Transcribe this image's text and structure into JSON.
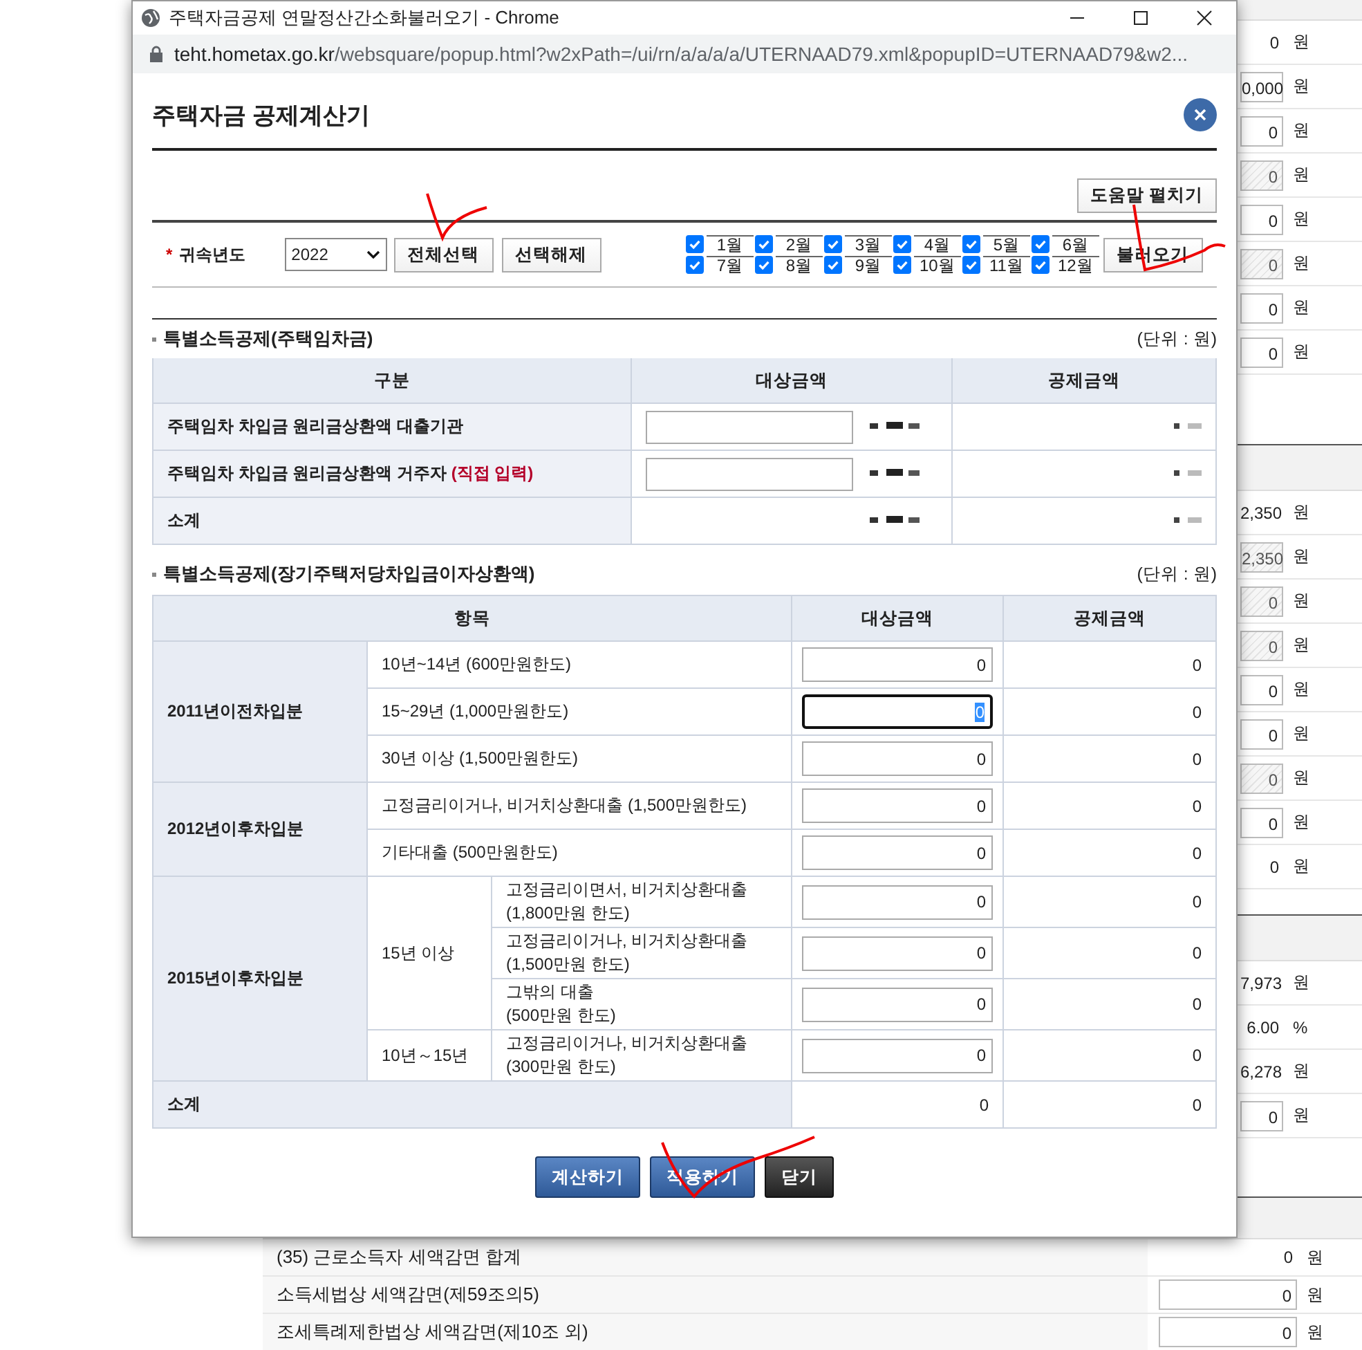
{
  "window": {
    "title": "주택자금공제 연말정산간소화불러오기 - Chrome",
    "url_host": "teht.hometax.go.kr",
    "url_path": "/websquare/popup.html?w2xPath=/ui/rn/a/a/a/a/UTERNAAD79.xml&popupID=UTERNAAD79&w2..."
  },
  "dialog": {
    "title": "주택자금 공제계산기",
    "help_button": "도움말 펼치기",
    "required_mark": "*",
    "year_label": "귀속년도",
    "year_value": "2022",
    "select_all": "전체선택",
    "deselect": "선택해제",
    "load_button": "불러오기",
    "months": [
      {
        "label": "1월",
        "checked": true
      },
      {
        "label": "2월",
        "checked": true
      },
      {
        "label": "3월",
        "checked": true
      },
      {
        "label": "4월",
        "checked": true
      },
      {
        "label": "5월",
        "checked": true
      },
      {
        "label": "6월",
        "checked": true
      },
      {
        "label": "7월",
        "checked": true
      },
      {
        "label": "8월",
        "checked": true
      },
      {
        "label": "9월",
        "checked": true
      },
      {
        "label": "10월",
        "checked": true
      },
      {
        "label": "11월",
        "checked": true
      },
      {
        "label": "12월",
        "checked": true
      }
    ]
  },
  "section1": {
    "title": "특별소득공제(주택임차금)",
    "unit": "(단위 : 원)",
    "columns": [
      "구분",
      "대상금액",
      "공제금액"
    ],
    "rows": [
      {
        "label": "주택임차 차입금 원리금상환액 대출기관",
        "note": "",
        "kind": "input"
      },
      {
        "label": "주택임차 차입금 원리금상환액 거주자",
        "note": "(직접 입력)",
        "kind": "input"
      },
      {
        "label": "소계",
        "note": "",
        "kind": "total"
      }
    ]
  },
  "section2": {
    "title": "특별소득공제(장기주택저당차입금이자상환액)",
    "unit": "(단위 : 원)",
    "columns": [
      "항목",
      "대상금액",
      "공제금액"
    ],
    "groups": [
      {
        "label": "2011년이전차입분",
        "children": [
          {
            "kind": "item",
            "label": "10년~14년 (600만원한도)",
            "input": "0",
            "amount": "0",
            "focused": false
          },
          {
            "kind": "item",
            "label": "15~29년 (1,000만원한도)",
            "input": "0",
            "amount": "0",
            "focused": true
          },
          {
            "kind": "item",
            "label": "30년 이상 (1,500만원한도)",
            "input": "0",
            "amount": "0",
            "focused": false
          }
        ]
      },
      {
        "label": "2012년이후차입분",
        "children": [
          {
            "kind": "item",
            "label": "고정금리이거나, 비거치상환대출 (1,500만원한도)",
            "input": "0",
            "amount": "0",
            "focused": false
          },
          {
            "kind": "item",
            "label": "기타대출 (500만원한도)",
            "input": "0",
            "amount": "0",
            "focused": false
          }
        ]
      },
      {
        "label": "2015년이후차입분",
        "children": [
          {
            "kind": "subgroup",
            "label": "15년 이상",
            "children": [
              {
                "kind": "item",
                "label": "고정금리이면서, 비거치상환대출\n(1,800만원 한도)",
                "input": "0",
                "amount": "0",
                "focused": false
              },
              {
                "kind": "item",
                "label": "고정금리이거나, 비거치상환대출\n(1,500만원 한도)",
                "input": "0",
                "amount": "0",
                "focused": false
              },
              {
                "kind": "item",
                "label": "그밖의 대출\n(500만원 한도)",
                "input": "0",
                "amount": "0",
                "focused": false
              }
            ]
          },
          {
            "kind": "subgroup",
            "label": "10년～15년",
            "children": [
              {
                "kind": "item",
                "label": "고정금리이거나, 비거치상환대출\n(300만원 한도)",
                "input": "0",
                "amount": "0",
                "focused": false
              }
            ]
          }
        ]
      }
    ],
    "subtotal": {
      "label": "소계",
      "target": "0",
      "amount": "0"
    }
  },
  "buttons": [
    {
      "label": "계산하기",
      "kind": "primary"
    },
    {
      "label": "적용하기",
      "kind": "primary"
    },
    {
      "label": "닫기",
      "kind": "dark"
    }
  ],
  "background": {
    "right_sections": [
      {
        "rows": [
          {
            "kind": "text",
            "value": "0",
            "unit": "원"
          },
          {
            "kind": "field",
            "value": "0,000",
            "unit": "원"
          },
          {
            "kind": "field",
            "value": "0",
            "unit": "원"
          },
          {
            "kind": "disabled",
            "value": "0",
            "unit": "원"
          },
          {
            "kind": "field",
            "value": "0",
            "unit": "원"
          },
          {
            "kind": "disabled",
            "value": "0",
            "unit": "원"
          },
          {
            "kind": "field",
            "value": "0",
            "unit": "원"
          },
          {
            "kind": "field",
            "value": "0",
            "unit": "원"
          }
        ]
      },
      {
        "rows": [
          {
            "kind": "text",
            "value": "2,350",
            "unit": "원"
          },
          {
            "kind": "disabled",
            "value": "2,350",
            "unit": "원"
          },
          {
            "kind": "disabled",
            "value": "0",
            "unit": "원"
          },
          {
            "kind": "disabled",
            "value": "0",
            "unit": "원"
          },
          {
            "kind": "field",
            "value": "0",
            "unit": "원"
          },
          {
            "kind": "field",
            "value": "0",
            "unit": "원"
          },
          {
            "kind": "disabled",
            "value": "0",
            "unit": "원"
          },
          {
            "kind": "field",
            "value": "0",
            "unit": "원"
          },
          {
            "kind": "text",
            "value": "0",
            "unit": "원"
          }
        ]
      },
      {
        "rows": [
          {
            "kind": "text",
            "value": "7,973",
            "unit": "원"
          },
          {
            "kind": "text",
            "value": "6.00",
            "unit": "%"
          },
          {
            "kind": "text",
            "value": "6,278",
            "unit": "원"
          },
          {
            "kind": "field",
            "value": "0",
            "unit": "원"
          }
        ]
      }
    ],
    "bottom_rows": [
      {
        "label": "(35) 근로소득자 세액감면 합계",
        "kind": "text",
        "value": "0",
        "unit": "원"
      },
      {
        "label": "소득세법상 세액감면(제59조의5)",
        "kind": "field",
        "value": "0",
        "unit": "원"
      },
      {
        "label": "조세특례제한법상 세액감면(제10조 외)",
        "kind": "field",
        "value": "0",
        "unit": "원"
      }
    ]
  }
}
